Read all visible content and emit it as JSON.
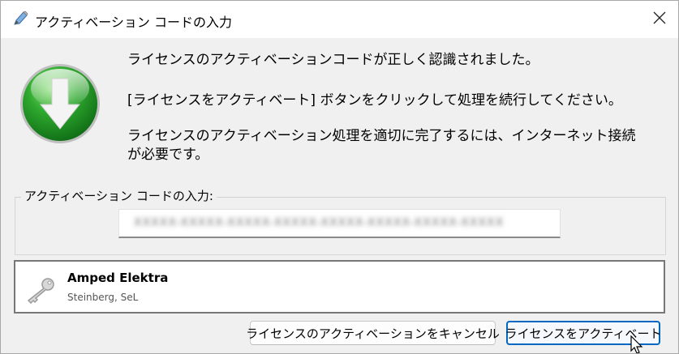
{
  "window": {
    "title": "アクティベーション コードの入力",
    "close_icon": "close-icon",
    "title_icon": "pencil-icon"
  },
  "main": {
    "status_icon": "green-download-arrow-icon",
    "message1": "ライセンスのアクティベーションコードが正しく認識されました。",
    "message2": "[ライセンスをアクティベート] ボタンをクリックして処理を続行してください。",
    "message3_line1": "ライセンスのアクティベーション処理を適切に完了するには、インターネット接続",
    "message3_line2": "が必要です。"
  },
  "code_group": {
    "label": "アクティベーション コードの入力:",
    "code_value": "XXXXX-XXXXX-XXXXX-XXXXX-XXXXX-XXXXX-XXXXX-XXXXX"
  },
  "license_list": {
    "items": [
      {
        "icon": "key-icon",
        "name": "Amped Elektra",
        "vendor": "Steinberg, SeL"
      }
    ]
  },
  "buttons": {
    "cancel_label": "ライセンスのアクティベーションをキャンセル",
    "activate_label": "ライセンスをアクティベート"
  },
  "colors": {
    "accent": "#0067c0",
    "icon_green": "#2fa82f",
    "background": "#f0f0f0"
  }
}
